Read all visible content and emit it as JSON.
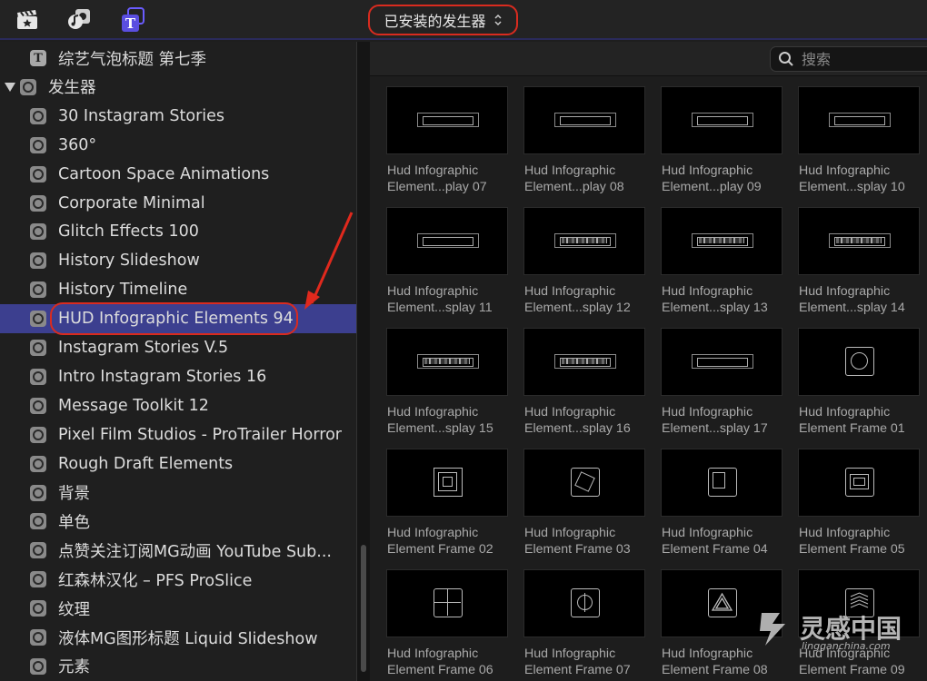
{
  "topbar": {
    "icons": [
      "clapper-icon",
      "music-photo-icon",
      "titles-generators-icon"
    ],
    "selector_label": "已安装的发生器"
  },
  "sidebar": {
    "items": [
      {
        "label": "综艺气泡标题 第七季",
        "icon": "title-icon",
        "level": 1
      },
      {
        "label": "发生器",
        "icon": "generator-icon",
        "level": 0,
        "expanded": true
      },
      {
        "label": "30 Instagram Stories",
        "icon": "generator-icon",
        "level": 1
      },
      {
        "label": "360°",
        "icon": "generator-icon",
        "level": 1
      },
      {
        "label": "Cartoon Space Animations",
        "icon": "generator-icon",
        "level": 1
      },
      {
        "label": "Corporate Minimal",
        "icon": "generator-icon",
        "level": 1
      },
      {
        "label": "Glitch Effects 100",
        "icon": "generator-icon",
        "level": 1
      },
      {
        "label": "History Slideshow",
        "icon": "generator-icon",
        "level": 1
      },
      {
        "label": "History Timeline",
        "icon": "generator-icon",
        "level": 1
      },
      {
        "label": "HUD Infographic Elements 94",
        "icon": "generator-icon",
        "level": 1,
        "selected": true
      },
      {
        "label": "Instagram Stories V.5",
        "icon": "generator-icon",
        "level": 1
      },
      {
        "label": "Intro Instagram Stories 16",
        "icon": "generator-icon",
        "level": 1
      },
      {
        "label": "Message Toolkit 12",
        "icon": "generator-icon",
        "level": 1
      },
      {
        "label": "Pixel Film Studios - ProTrailer Horror",
        "icon": "generator-icon",
        "level": 1
      },
      {
        "label": "Rough Draft Elements",
        "icon": "generator-icon",
        "level": 1
      },
      {
        "label": "背景",
        "icon": "generator-icon",
        "level": 1
      },
      {
        "label": "单色",
        "icon": "generator-icon",
        "level": 1
      },
      {
        "label": "点赞关注订阅MG动画 YouTube Sub...",
        "icon": "generator-icon",
        "level": 1
      },
      {
        "label": "红森林汉化 – PFS ProSlice",
        "icon": "generator-icon",
        "level": 1
      },
      {
        "label": "纹理",
        "icon": "generator-icon",
        "level": 1
      },
      {
        "label": "液体MG图形标题 Liquid Slideshow",
        "icon": "generator-icon",
        "level": 1
      },
      {
        "label": "元素",
        "icon": "generator-icon",
        "level": 1
      }
    ]
  },
  "search": {
    "placeholder": "搜索",
    "value": ""
  },
  "tiles": [
    {
      "line1": "Hud Infographic",
      "line2": "Element...play 07",
      "thumb": "bar"
    },
    {
      "line1": "Hud Infographic",
      "line2": "Element...play 08",
      "thumb": "bar"
    },
    {
      "line1": "Hud Infographic",
      "line2": "Element...play 09",
      "thumb": "bar"
    },
    {
      "line1": "Hud Infographic",
      "line2": "Element...splay 10",
      "thumb": "bar"
    },
    {
      "line1": "Hud Infographic",
      "line2": "Element...splay 11",
      "thumb": "bar"
    },
    {
      "line1": "Hud Infographic",
      "line2": "Element...splay 12",
      "thumb": "bar-tex"
    },
    {
      "line1": "Hud Infographic",
      "line2": "Element...splay 13",
      "thumb": "bar-tex"
    },
    {
      "line1": "Hud Infographic",
      "line2": "Element...splay 14",
      "thumb": "bar-tex"
    },
    {
      "line1": "Hud Infographic",
      "line2": "Element...splay 15",
      "thumb": "bar-tex"
    },
    {
      "line1": "Hud Infographic",
      "line2": "Element...splay 16",
      "thumb": "bar-tex"
    },
    {
      "line1": "Hud Infographic",
      "line2": "Element...splay 17",
      "thumb": "bar"
    },
    {
      "line1": "Hud Infographic",
      "line2": "Element Frame 01",
      "thumb": "circle"
    },
    {
      "line1": "Hud Infographic",
      "line2": "Element Frame 02",
      "thumb": "nested"
    },
    {
      "line1": "Hud Infographic",
      "line2": "Element Frame 03",
      "thumb": "rotated"
    },
    {
      "line1": "Hud Infographic",
      "line2": "Element Frame 04",
      "thumb": "corner"
    },
    {
      "line1": "Hud Infographic",
      "line2": "Element Frame 05",
      "thumb": "grid"
    },
    {
      "line1": "Hud Infographic",
      "line2": "Element Frame 06",
      "thumb": "cross"
    },
    {
      "line1": "Hud Infographic",
      "line2": "Element Frame 07",
      "thumb": "circle-line"
    },
    {
      "line1": "Hud Infographic",
      "line2": "Element Frame 08",
      "thumb": "triangle"
    },
    {
      "line1": "Hud Infographic",
      "line2": "Element Frame 09",
      "thumb": "stack"
    }
  ],
  "watermark": {
    "brand": "灵感中国",
    "url": "lingganchina.com"
  },
  "colors": {
    "selection": "#3c3f8f",
    "highlight": "#d92b1f",
    "accent": "#6a5cff"
  }
}
